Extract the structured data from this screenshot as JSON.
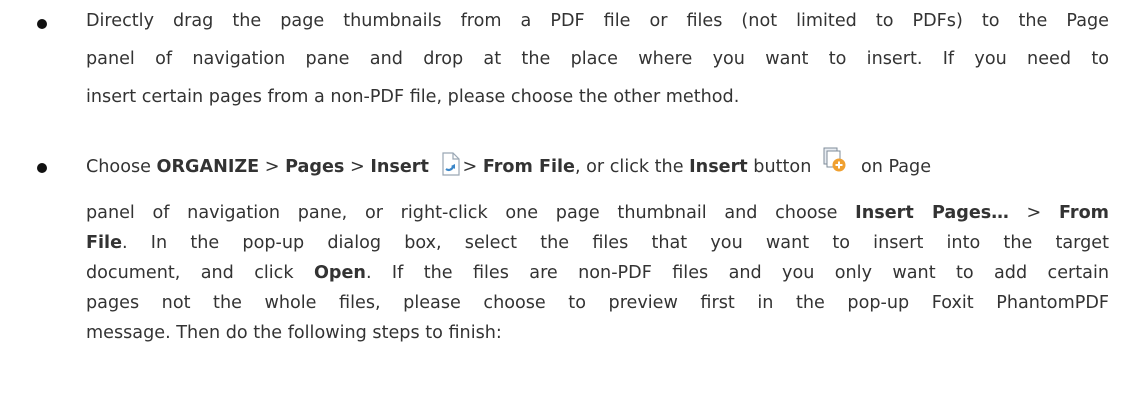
{
  "bullets": [
    {
      "lines": [
        "Directly drag the page thumbnails from a PDF file or files (not limited to PDFs) to the Page",
        "panel of navigation pane and drop at the place where you want to insert. If you need to",
        "insert certain pages from a non-PDF file, please choose the other method."
      ]
    },
    {
      "line1": {
        "choose": "Choose ",
        "organize": "ORGANIZE",
        "sep1": " > ",
        "pages": "Pages",
        "sep2": " > ",
        "insert": "Insert",
        "sep3": "> ",
        "from_file": "From File",
        "mid": ", or click the ",
        "insert2": "Insert",
        "mid2": " button",
        "end": "on Page"
      },
      "line2": {
        "text": "panel of navigation pane, or right-click one page thumbnail and choose ",
        "insert_pages": "Insert Pages…",
        "sep": " > ",
        "from": "From"
      },
      "line3": {
        "file": "File",
        "text": ". In the pop-up dialog box, select the files that you want to insert into the target"
      },
      "line4": {
        "text": "document, and click ",
        "open": "Open",
        "text2": ". If the files are non-PDF files and you only want to add certain"
      },
      "line5": "pages not the whole files, please choose to preview first in the pop-up Foxit PhantomPDF",
      "line6": "message. Then do the following steps to finish:"
    }
  ],
  "icons": {
    "insert_page_icon": "page-with-blue-arrow-icon",
    "insert_button_icon": "insert-pages-button-icon",
    "accent_blue": "#3a86c8",
    "accent_orange": "#f0a030"
  }
}
